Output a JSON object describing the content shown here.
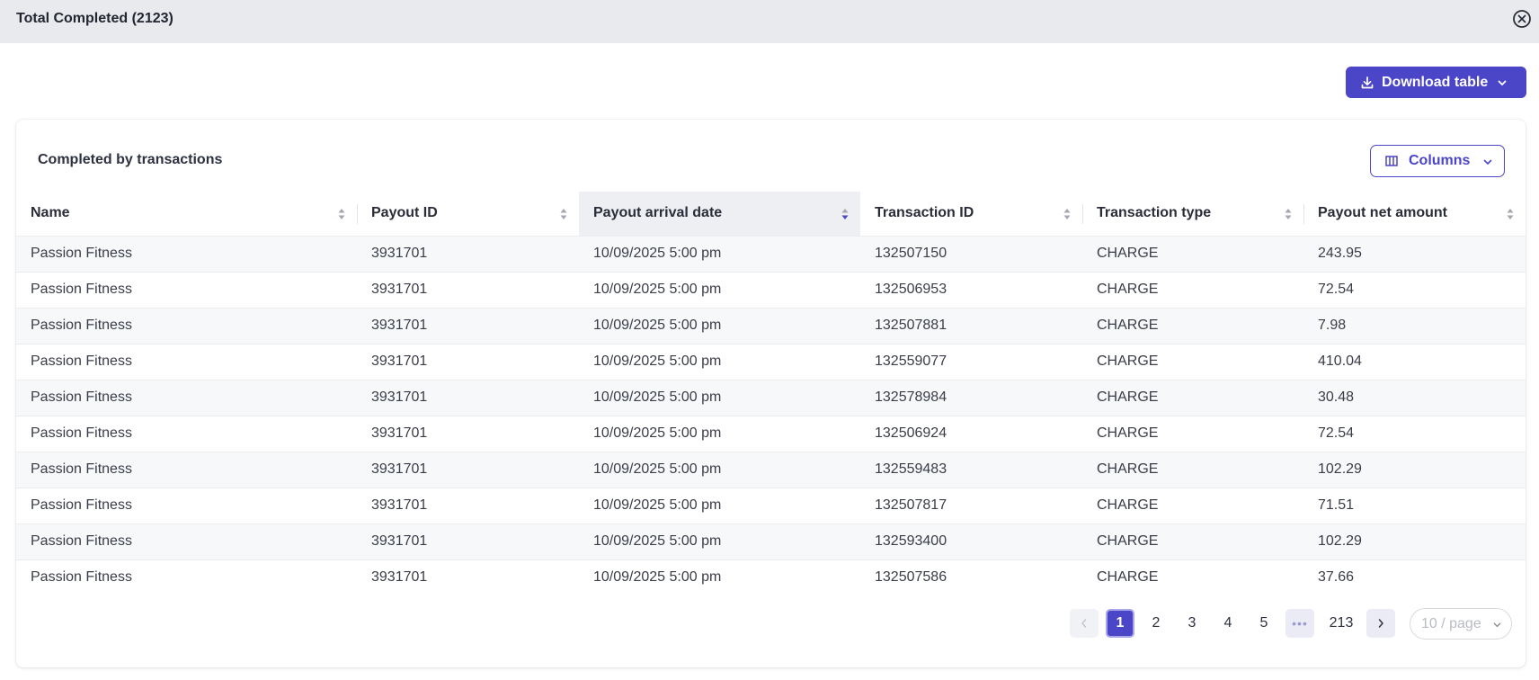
{
  "header": {
    "title": "Total Completed (2123)"
  },
  "toolbar": {
    "download_label": "Download table"
  },
  "card": {
    "title": "Completed by transactions",
    "columns_label": "Columns"
  },
  "table": {
    "columns": [
      "Name",
      "Payout ID",
      "Payout arrival date",
      "Transaction ID",
      "Transaction type",
      "Payout net amount"
    ],
    "sorted_column": "Payout arrival date",
    "rows": [
      [
        "Passion Fitness",
        "3931701",
        "10/09/2025 5:00 pm",
        "132507150",
        "CHARGE",
        "243.95"
      ],
      [
        "Passion Fitness",
        "3931701",
        "10/09/2025 5:00 pm",
        "132506953",
        "CHARGE",
        "72.54"
      ],
      [
        "Passion Fitness",
        "3931701",
        "10/09/2025 5:00 pm",
        "132507881",
        "CHARGE",
        "7.98"
      ],
      [
        "Passion Fitness",
        "3931701",
        "10/09/2025 5:00 pm",
        "132559077",
        "CHARGE",
        "410.04"
      ],
      [
        "Passion Fitness",
        "3931701",
        "10/09/2025 5:00 pm",
        "132578984",
        "CHARGE",
        "30.48"
      ],
      [
        "Passion Fitness",
        "3931701",
        "10/09/2025 5:00 pm",
        "132506924",
        "CHARGE",
        "72.54"
      ],
      [
        "Passion Fitness",
        "3931701",
        "10/09/2025 5:00 pm",
        "132559483",
        "CHARGE",
        "102.29"
      ],
      [
        "Passion Fitness",
        "3931701",
        "10/09/2025 5:00 pm",
        "132507817",
        "CHARGE",
        "71.51"
      ],
      [
        "Passion Fitness",
        "3931701",
        "10/09/2025 5:00 pm",
        "132593400",
        "CHARGE",
        "102.29"
      ],
      [
        "Passion Fitness",
        "3931701",
        "10/09/2025 5:00 pm",
        "132507586",
        "CHARGE",
        "37.66"
      ]
    ]
  },
  "pagination": {
    "pages": [
      "1",
      "2",
      "3",
      "4",
      "5"
    ],
    "current": "1",
    "ellipsis": "•••",
    "last": "213",
    "page_size": "10 / page"
  },
  "colors": {
    "accent": "#4b45c7",
    "header_bg": "#e9eaee",
    "row_alt": "#f7f8fa"
  },
  "icons": {
    "close": "close-circle-icon",
    "download": "download-icon",
    "columns": "columns-icon",
    "sort": "sort-icon",
    "chevron": "chevron-down-icon",
    "prev": "chevron-left-icon",
    "next": "chevron-right-icon"
  }
}
